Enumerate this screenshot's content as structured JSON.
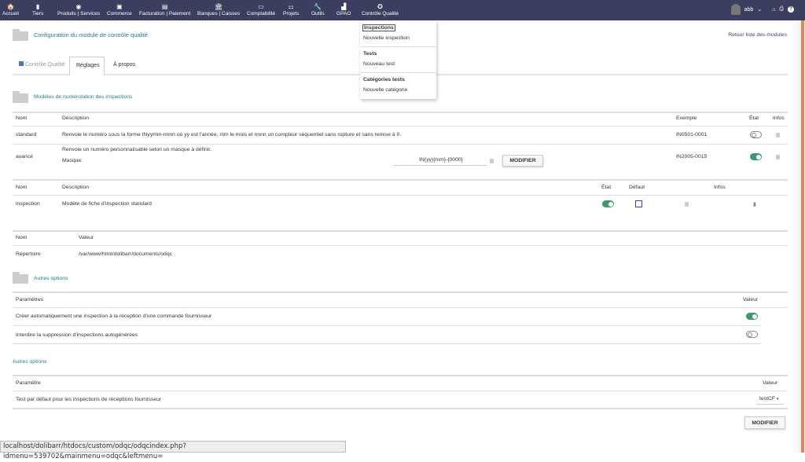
{
  "topnav": {
    "items": [
      {
        "label": "Accueil",
        "icon": "home-icon",
        "g": "🏠"
      },
      {
        "label": "Tiers",
        "icon": "building-icon",
        "g": "▮"
      },
      {
        "label": "Produits | Services",
        "icon": "cube-icon",
        "g": "◉"
      },
      {
        "label": "Commerce",
        "icon": "briefcase-icon",
        "g": "▣"
      },
      {
        "label": "Facturation | Paiement",
        "icon": "invoice-icon",
        "g": "▤"
      },
      {
        "label": "Banques | Caisses",
        "icon": "bank-icon",
        "g": "🏛"
      },
      {
        "label": "Comptabilité",
        "icon": "ledger-icon",
        "g": "▭"
      },
      {
        "label": "Projets",
        "icon": "sitemap-icon",
        "g": "⚏"
      },
      {
        "label": "Outils",
        "icon": "wrench-icon",
        "g": "🔧"
      },
      {
        "label": "GPAO",
        "icon": "factory-icon",
        "g": "▟"
      },
      {
        "label": "Contrôle Qualité",
        "icon": "award-icon",
        "g": "✪"
      }
    ],
    "user": "abb"
  },
  "dropdown": {
    "items": [
      "Inspections",
      "Nouvelle inspection",
      "Tests",
      "Nouveau test",
      "Catégories tests",
      "Nouvelle catégorie"
    ]
  },
  "page": {
    "title": "Configuration du module de contrôle qualité",
    "back_link": "Retour liste des modules",
    "tabs": [
      "Contrôle Qualité",
      "Réglages",
      "À propos"
    ]
  },
  "numbering": {
    "title": "Modèles de numérotation des inspections",
    "headers": [
      "Nom",
      "Description",
      "Exemple",
      "État",
      "Infos"
    ],
    "rows": [
      {
        "name": "standard",
        "description": "Renvoie le numéro sous la forme INyymm-nnnn où yy est l'année, mm le mois et nnnn un compteur séquentiel sans rupture et sans remise à 0.",
        "example": "IN0501-0001",
        "enabled": false
      },
      {
        "name": "avancé",
        "description": "Renvoie un numéro personnalisable selon un masque à définir.",
        "mask_label": "Masque:",
        "mask_value": "IN{yy}{mm}-{0000}",
        "button": "MODIFIER",
        "example": "IN2005-0015",
        "enabled": true
      }
    ]
  },
  "models": {
    "headers": [
      "Nom",
      "Description",
      "État",
      "Défaut",
      "Infos"
    ],
    "rows": [
      {
        "name": "inspection",
        "description": "Modèle de fiche d'inspection standard",
        "enabled": true,
        "default": false
      }
    ]
  },
  "directory": {
    "headers": [
      "Nom",
      "Valeur"
    ],
    "rows": [
      {
        "name": "Répertoire",
        "value": "/var/www/html/dolibarr/documents/odqc"
      }
    ]
  },
  "other": {
    "title": "Autres options",
    "headers": [
      "Paramètres",
      "Valeur"
    ],
    "rows": [
      {
        "label": "Créer automatiquement une inspection à la réception d'une commande fournisseur",
        "enabled": true
      },
      {
        "label": "Interdire la suppression d'inspections autogénérées",
        "enabled": false
      }
    ]
  },
  "other2": {
    "title": "Autres options",
    "headers": [
      "Paramètre",
      "Valeur"
    ],
    "rows": [
      {
        "label": "Test par défaut pour les inspections de réceptions fournisseur",
        "value": "testCF"
      }
    ],
    "button": "MODIFIER"
  },
  "status_url": "localhost/dolibarr/htdocs/custom/odqc/odqcindex.php?idmenu=539702&mainmenu=odqc&leftmenu="
}
